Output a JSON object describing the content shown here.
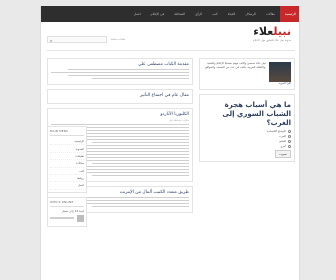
{
  "nav": {
    "items": [
      "الرئيسية",
      "مقالات",
      "الرسائل",
      "الحياة",
      "كتب",
      "الرأي",
      "الصحافة",
      "في الإعلام",
      "اتصل"
    ]
  },
  "logo": {
    "accent": "نبيل",
    "main": "علاء"
  },
  "tagline": "مدونة نبيل علاء للتعليق حول الإعلام",
  "search": {
    "placeholder": ""
  },
  "breadcrumb": "حلقات سابقة",
  "main": {
    "posts": [
      {
        "title": "مقدمة الكتاب مصطفى علي",
        "meta": ""
      },
      {
        "title": "مقال عام في اجتماع التأثير",
        "meta": ""
      },
      {
        "title": "الكلتوريا الآتاردو",
        "meta": "مكتوب بواسطة نبيل"
      },
      {
        "title": "طريق متعدد الكتيب ألمال من الإنترنت",
        "meta": ""
      }
    ]
  },
  "side": {
    "main_menu_head": "MAIN MENU",
    "menu_items": [
      "الرئيسية",
      "المدونة",
      "تعليقات",
      "مقالات",
      "كتب",
      "روابط",
      "اتصل"
    ],
    "bio": {
      "text": "نبيل علاء صحفي وكاتب مهتم بقضايا الإعلام والتقنية والثقافة العربية، يكتب في عدد من الصحف والمواقع.",
      "link": "اقرأ المزيد"
    },
    "question": "ما هي أسباب هجرة الشباب السوري إلى الغرب؟",
    "poll_options": [
      "الأوضاع الاقتصادية",
      "الحرب",
      "التعليم",
      "أخرى"
    ],
    "vote_button": "تصويت",
    "who_online_head": "WHO'S ONLINE",
    "online_text": "لدينا 12 زائر متصل"
  }
}
